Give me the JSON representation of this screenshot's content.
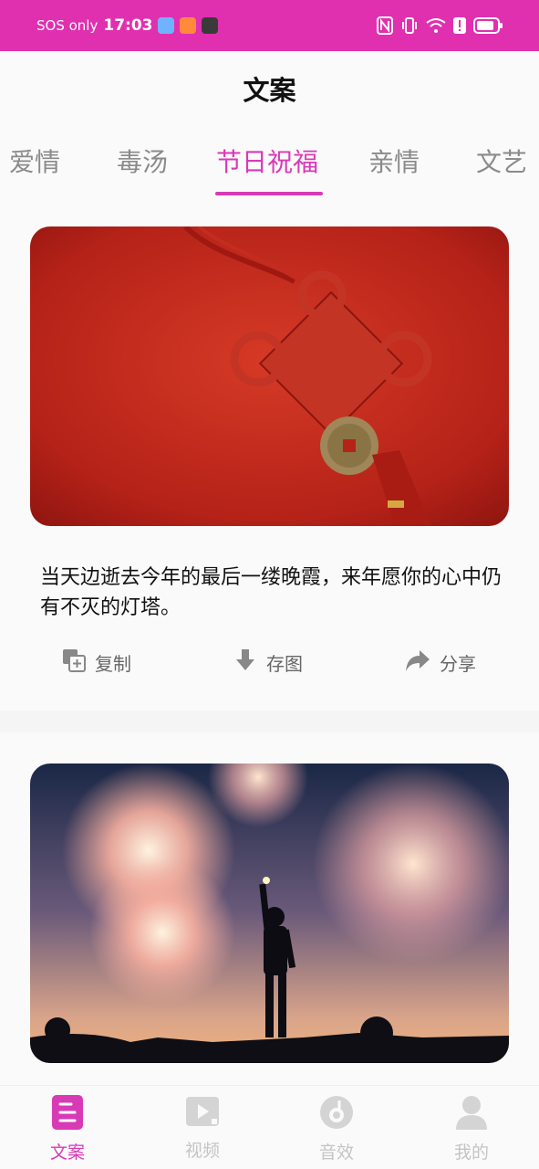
{
  "status_bar": {
    "carrier": "SOS only",
    "time": "17:03"
  },
  "header": {
    "title": "文案"
  },
  "tabs": [
    {
      "label": "爱情"
    },
    {
      "label": "毒汤"
    },
    {
      "label": "节日祝福",
      "active": true
    },
    {
      "label": "亲情"
    },
    {
      "label": "文艺"
    }
  ],
  "posts": [
    {
      "text": "当天边逝去今年的最后一缕晚霞，来年愿你的心中仍有不灭的灯塔。",
      "actions": {
        "copy": "复制",
        "save": "存图",
        "share": "分享"
      }
    }
  ],
  "bottom_nav": [
    {
      "label": "文案",
      "icon": "document-icon",
      "active": true
    },
    {
      "label": "视频",
      "icon": "video-icon"
    },
    {
      "label": "音效",
      "icon": "music-disc-icon"
    },
    {
      "label": "我的",
      "icon": "user-icon"
    }
  ],
  "colors": {
    "accent": "#d83ab6",
    "status_bar": "#e030b0"
  }
}
